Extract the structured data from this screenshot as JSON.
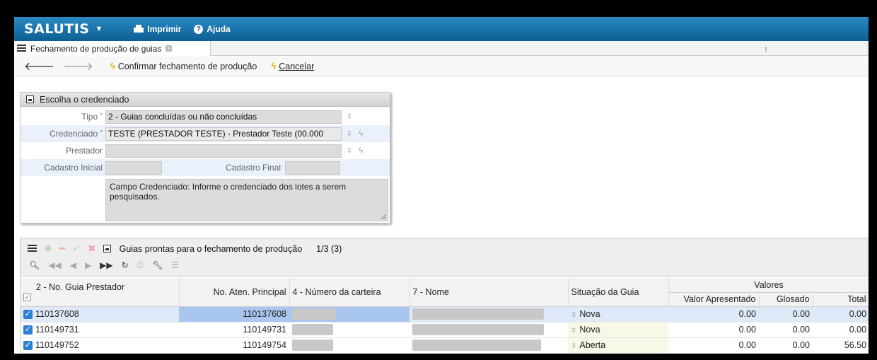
{
  "header": {
    "brand": "SALUTIS",
    "print_label": "Imprimir",
    "help_label": "Ajuda"
  },
  "tab": {
    "title": "Fechamento de produção de guias"
  },
  "toolbar": {
    "confirm_label": "Confirmar fechamento de produção",
    "cancel_label": "Cancelar"
  },
  "cred_panel": {
    "title": "Escolha o credenciado",
    "tipo_label": "Tipo",
    "tipo_value": "2 - Guias concluídas ou não concluídas",
    "credenciado_label": "Credenciado",
    "credenciado_value": "TESTE (PRESTADOR TESTE) - Prestador Teste (00.000",
    "prestador_label": "Prestador",
    "prestador_value": "",
    "cadastro_inicial_label": "Cadastro Inicial",
    "cadastro_final_label": "Cadastro Final",
    "help_text": "Campo Credenciado: Informe o credenciado dos lotes a serem pesquisados."
  },
  "guias_panel": {
    "title": "Guias prontas para o fechamento de produção",
    "count": "1/3 (3)",
    "columns": {
      "guia_prestador": "2 - No. Guia Prestador",
      "aten_principal": "No. Aten. Principal",
      "numero_carteira": "4 - Número da carteira",
      "nome": "7 - Nome",
      "situacao": "Situação da Guia",
      "valores_group": "Valores",
      "valor_apresentado": "Valor Apresentado",
      "glosado": "Glosado",
      "total": "Total"
    },
    "rows": [
      {
        "guia": "110137608",
        "aten": "110137608",
        "situacao": "Nova",
        "apresentado": "0.00",
        "glosado": "0.00",
        "total": "0.00"
      },
      {
        "guia": "110149731",
        "aten": "110149731",
        "situacao": "Nova",
        "apresentado": "0.00",
        "glosado": "0.00",
        "total": "0.00"
      },
      {
        "guia": "110149752",
        "aten": "110149754",
        "situacao": "Aberta",
        "apresentado": "0.00",
        "glosado": "0.00",
        "total": "56.50"
      }
    ]
  },
  "colors": {
    "header_blue": "#1674ac",
    "selected_row": "#a9c7ee",
    "checkbox_blue": "#2f7fd8",
    "bolt_yellow": "#e7b000"
  }
}
